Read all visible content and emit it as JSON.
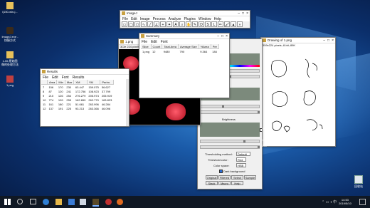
{
  "desktop": {
    "icons": [
      {
        "label": "ij150-win-j..."
      },
      {
        "label": "ImageJ.exe - 快捷方式"
      },
      {
        "label": "1-06 原始图像的处理方法"
      },
      {
        "label": "1.png"
      }
    ],
    "recycle_bin_label": "回收站"
  },
  "imagej": {
    "title": "ImageJ",
    "menus": [
      "File",
      "Edit",
      "Image",
      "Process",
      "Analyze",
      "Plugins",
      "Window",
      "Help"
    ]
  },
  "image_window": {
    "title": "1.png",
    "info": "3Cle 224 pixels; RGB; 244K"
  },
  "summary": {
    "title": "Summary",
    "menus": [
      "File",
      "Edit",
      "Font"
    ],
    "headers": [
      "Slice",
      "Count",
      "Total Area",
      "Average Size",
      "%Area",
      "Per"
    ],
    "rows": [
      [
        "1.png",
        "12",
        "9480",
        "790",
        "9.364",
        "184"
      ]
    ]
  },
  "results": {
    "title": "Results",
    "menus": [
      "File",
      "Edit",
      "Font",
      "Results"
    ],
    "headers": [
      "",
      "Area",
      "Min",
      "Max",
      "XM",
      "YM",
      "Perim."
    ],
    "rows": [
      [
        "7",
        "156",
        "170",
        "230",
        "63.447",
        "159.075",
        "56.627"
      ],
      [
        "8",
        "87",
        "120",
        "241",
        "172.756",
        "108.923",
        "37.799"
      ],
      [
        "9",
        "210",
        "126",
        "254",
        "276.279",
        "205.974",
        "205.919"
      ],
      [
        "10",
        "774",
        "109",
        "255",
        "162.659",
        "262.770",
        "163.823"
      ],
      [
        "11",
        "161",
        "180",
        "221",
        "51.661",
        "263.996",
        "46.284"
      ],
      [
        "12",
        "137",
        "191",
        "225",
        "93.213",
        "263.366",
        "46.096"
      ]
    ]
  },
  "threshold": {
    "brightness_label": "Brightness",
    "pass_label": "Pass",
    "value_147": "147",
    "value_255": "255",
    "method_label": "Thresholding method:",
    "method_value": "Default",
    "color_label": "Threshold color:",
    "color_value": "Red",
    "space_label": "Color space:",
    "space_value": "HSB",
    "dark_bg_label": "Dark background",
    "buttons": [
      "Original",
      "Filtered",
      "Select",
      "Sample",
      "Stack",
      "Macro",
      "Help"
    ]
  },
  "drawing": {
    "title": "Drawing of 1.png",
    "info": "359x224 pixels; 8-bit; 89K"
  },
  "taskbar": {
    "clock_time": "14:53",
    "clock_date": "2019/5/10"
  }
}
